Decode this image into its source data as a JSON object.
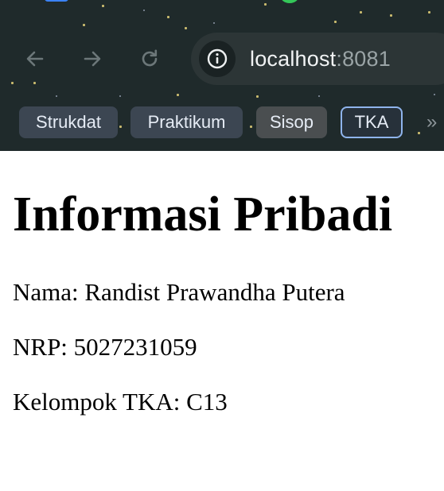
{
  "browser": {
    "url_host": "localhost",
    "url_port": ":8081",
    "icons": [
      "back-arrow-icon",
      "forward-arrow-icon",
      "reload-icon",
      "site-info-icon"
    ],
    "bookmarks": [
      {
        "label": "Strukdat"
      },
      {
        "label": "Praktikum"
      },
      {
        "label": "Sisop"
      },
      {
        "label": "TKA"
      }
    ],
    "bookmarks_overflow": "»"
  },
  "page": {
    "title": "Informasi Pribadi",
    "lines": [
      "Nama: Randist Prawandha Putera",
      "NRP: 5027231059",
      "Kelompok TKA: C13"
    ]
  }
}
